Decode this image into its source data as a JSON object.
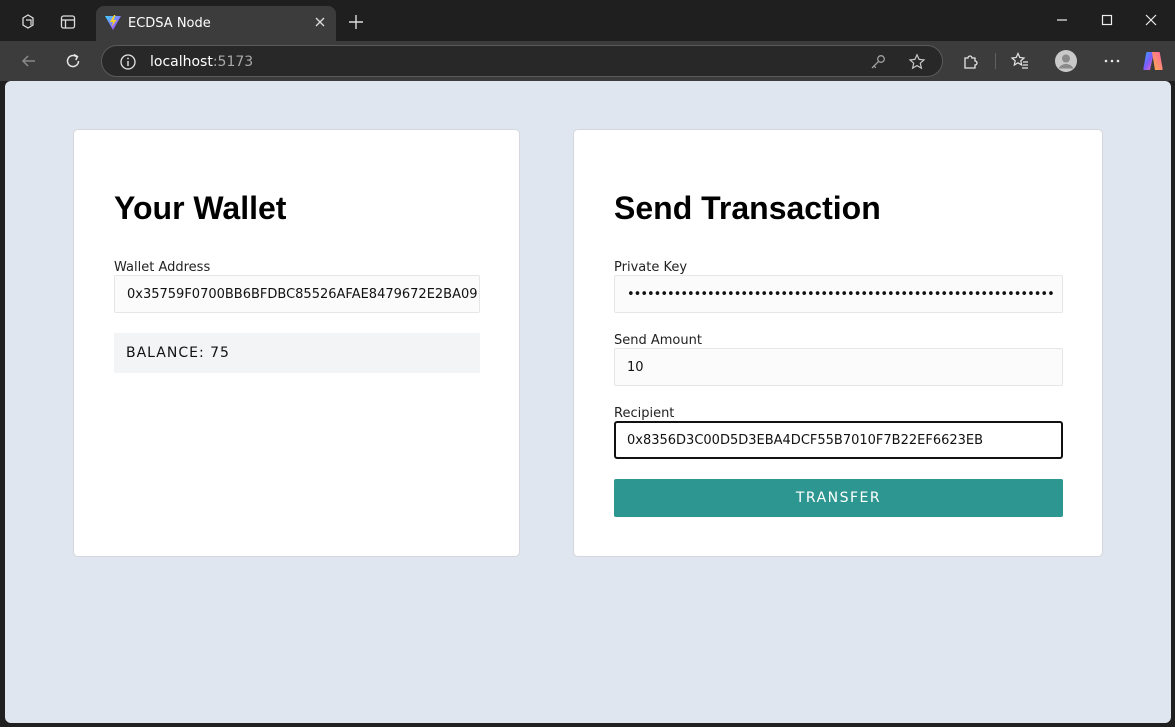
{
  "browser": {
    "tab_title": "ECDSA Node",
    "url_host": "localhost",
    "url_port": ":5173"
  },
  "wallet": {
    "title": "Your Wallet",
    "address_label": "Wallet Address",
    "address_value": "0x35759F0700BB6BFDBC85526AFAE8479672E2BA09",
    "balance_text": "BALANCE: 75"
  },
  "transaction": {
    "title": "Send Transaction",
    "private_key_label": "Private Key",
    "private_key_value": "••••••••••••••••••••••••••••••••••••••••••••••••••••••••••••••••",
    "amount_label": "Send Amount",
    "amount_value": "10",
    "recipient_label": "Recipient",
    "recipient_value": "0x8356D3C00D5D3EBA4DCF55B7010F7B22EF6623EB",
    "transfer_label": "TRANSFER"
  },
  "colors": {
    "page_bg": "#e0e6ef",
    "button": "#2e9690",
    "chrome_dark": "#1f1f1f",
    "chrome_toolbar": "#3c3c3c"
  },
  "icons": [
    "workspaces-icon",
    "tab-actions-icon",
    "vite-logo-icon",
    "close-tab-icon",
    "new-tab-icon",
    "minimize-icon",
    "maximize-icon",
    "close-window-icon",
    "back-icon",
    "refresh-icon",
    "site-info-icon",
    "key-icon",
    "favorite-star-icon",
    "extensions-icon",
    "favorites-icon",
    "profile-avatar-icon",
    "more-icon",
    "copilot-icon"
  ]
}
